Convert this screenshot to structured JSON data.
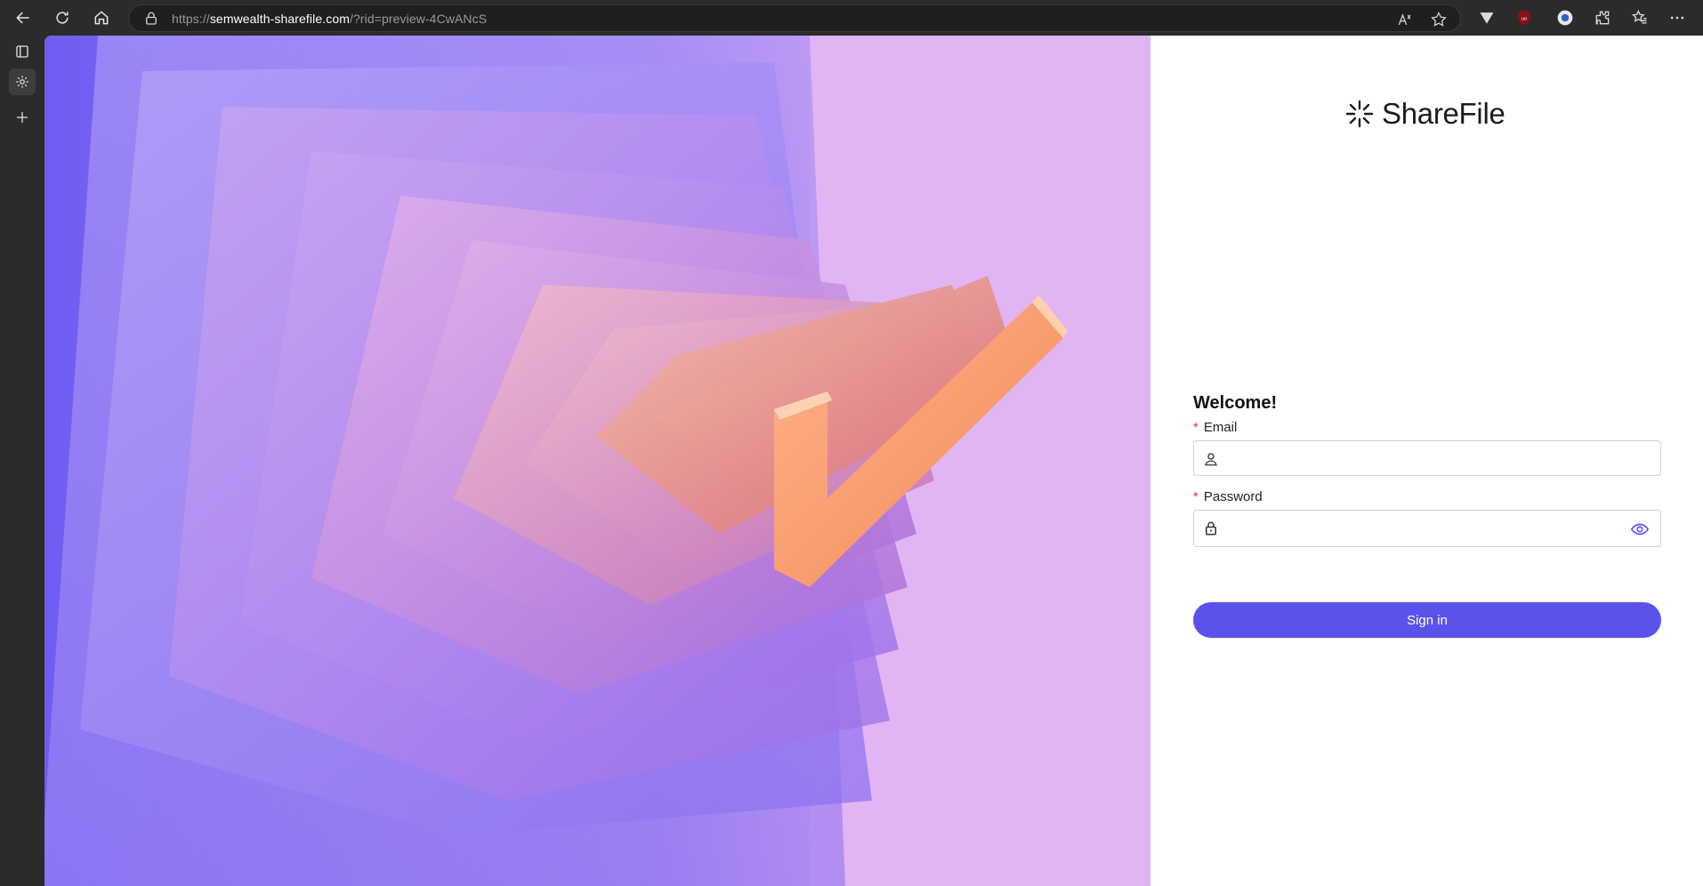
{
  "browser": {
    "url_scheme": "https://",
    "url_host": "semwealth-sharefile.com",
    "url_path": "/?rid=preview-4CwANcS",
    "icons": [
      "back-icon",
      "refresh-icon",
      "home-icon",
      "lock-icon",
      "read-aloud-icon",
      "favorite-star-icon",
      "extension-icon",
      "puzzle-icon",
      "favorites-icon",
      "more-icon"
    ]
  },
  "sidebar": {
    "icons": [
      "tab-actions-icon",
      "active-tab-icon",
      "new-tab-icon"
    ]
  },
  "brand": {
    "name": "ShareFile",
    "accent": "#5a52eb"
  },
  "login": {
    "welcome": "Welcome!",
    "email_label": "Email",
    "email_value": "",
    "password_label": "Password",
    "password_value": "",
    "required_mark": "*",
    "sign_in_label": "Sign in"
  }
}
